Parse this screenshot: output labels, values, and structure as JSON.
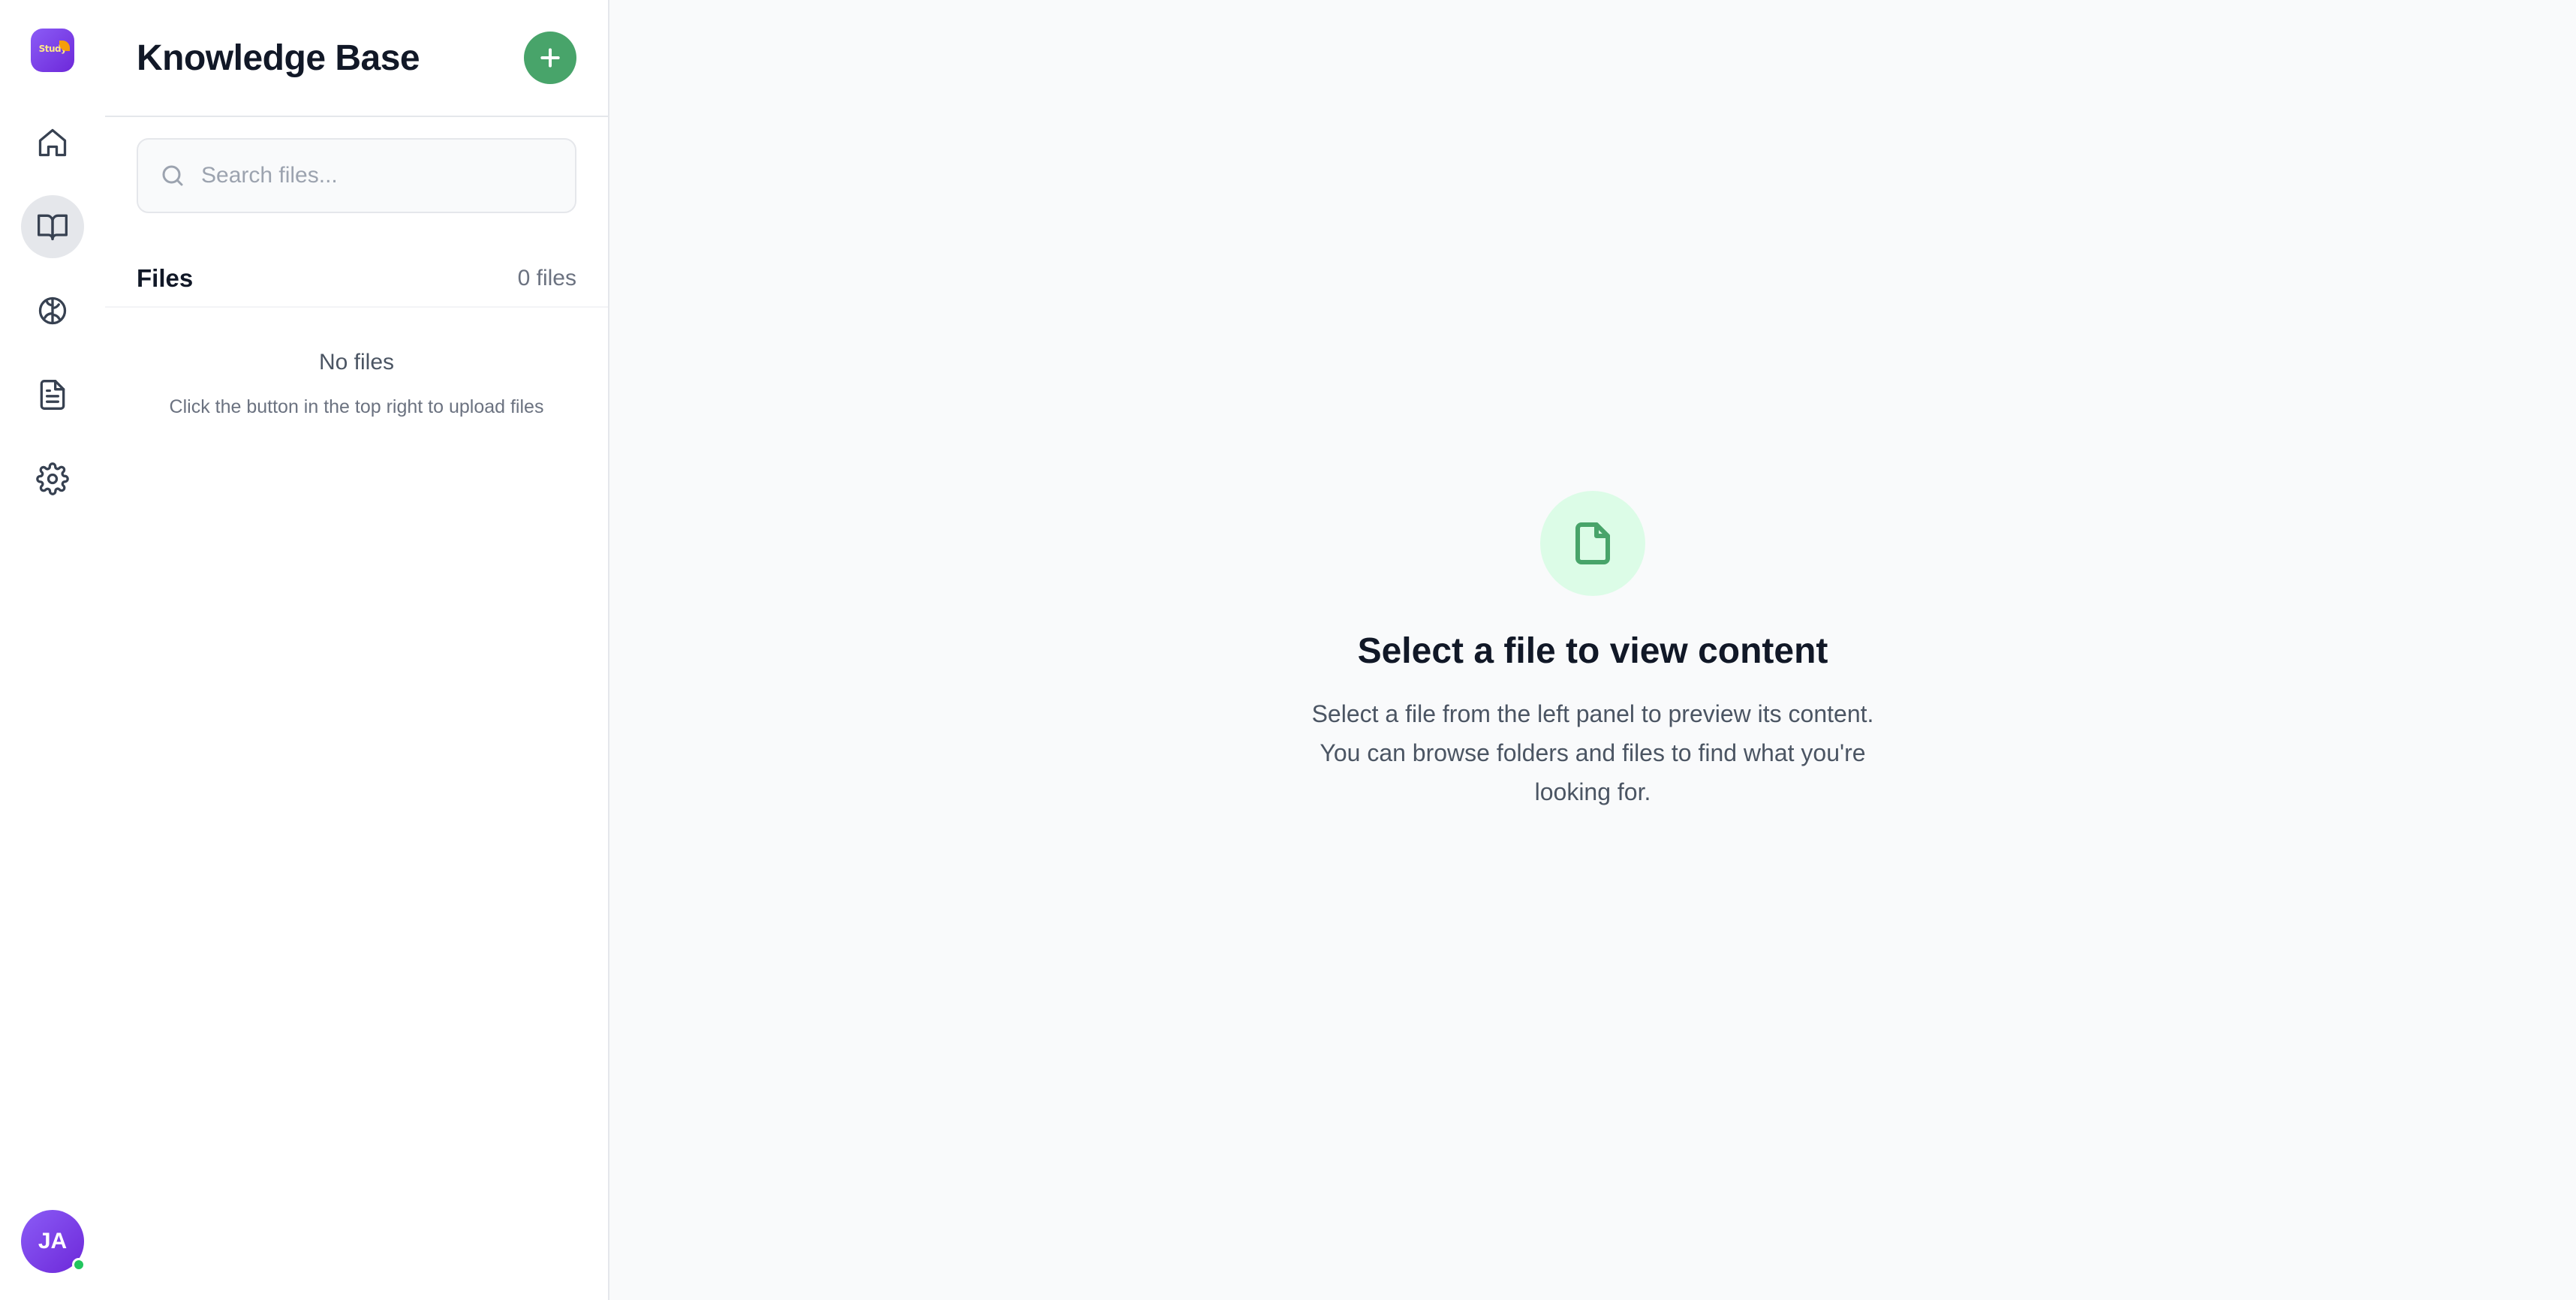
{
  "rail": {
    "logo_text": "Study",
    "nav": [
      {
        "name": "home-icon"
      },
      {
        "name": "book-open-icon",
        "active": true
      },
      {
        "name": "brain-icon"
      },
      {
        "name": "file-text-icon"
      },
      {
        "name": "gear-icon"
      }
    ],
    "avatar_initials": "JA",
    "presence_color": "#22c55e"
  },
  "panel": {
    "title": "Knowledge Base",
    "add_icon": "plus-icon",
    "search_placeholder": "Search files...",
    "files_label": "Files",
    "files_count": "0 files",
    "empty_title": "No files",
    "empty_subtitle": "Click the button in the top right to upload files"
  },
  "main": {
    "icon": "file-icon",
    "title": "Select a file to view content",
    "description": "Select a file from the left panel to preview its content. You can browse folders and files to find what you're looking for."
  },
  "colors": {
    "accent_green": "#48a46a",
    "brand_purple": "#7c3aed",
    "active_nav_bg": "#e5e7eb"
  }
}
